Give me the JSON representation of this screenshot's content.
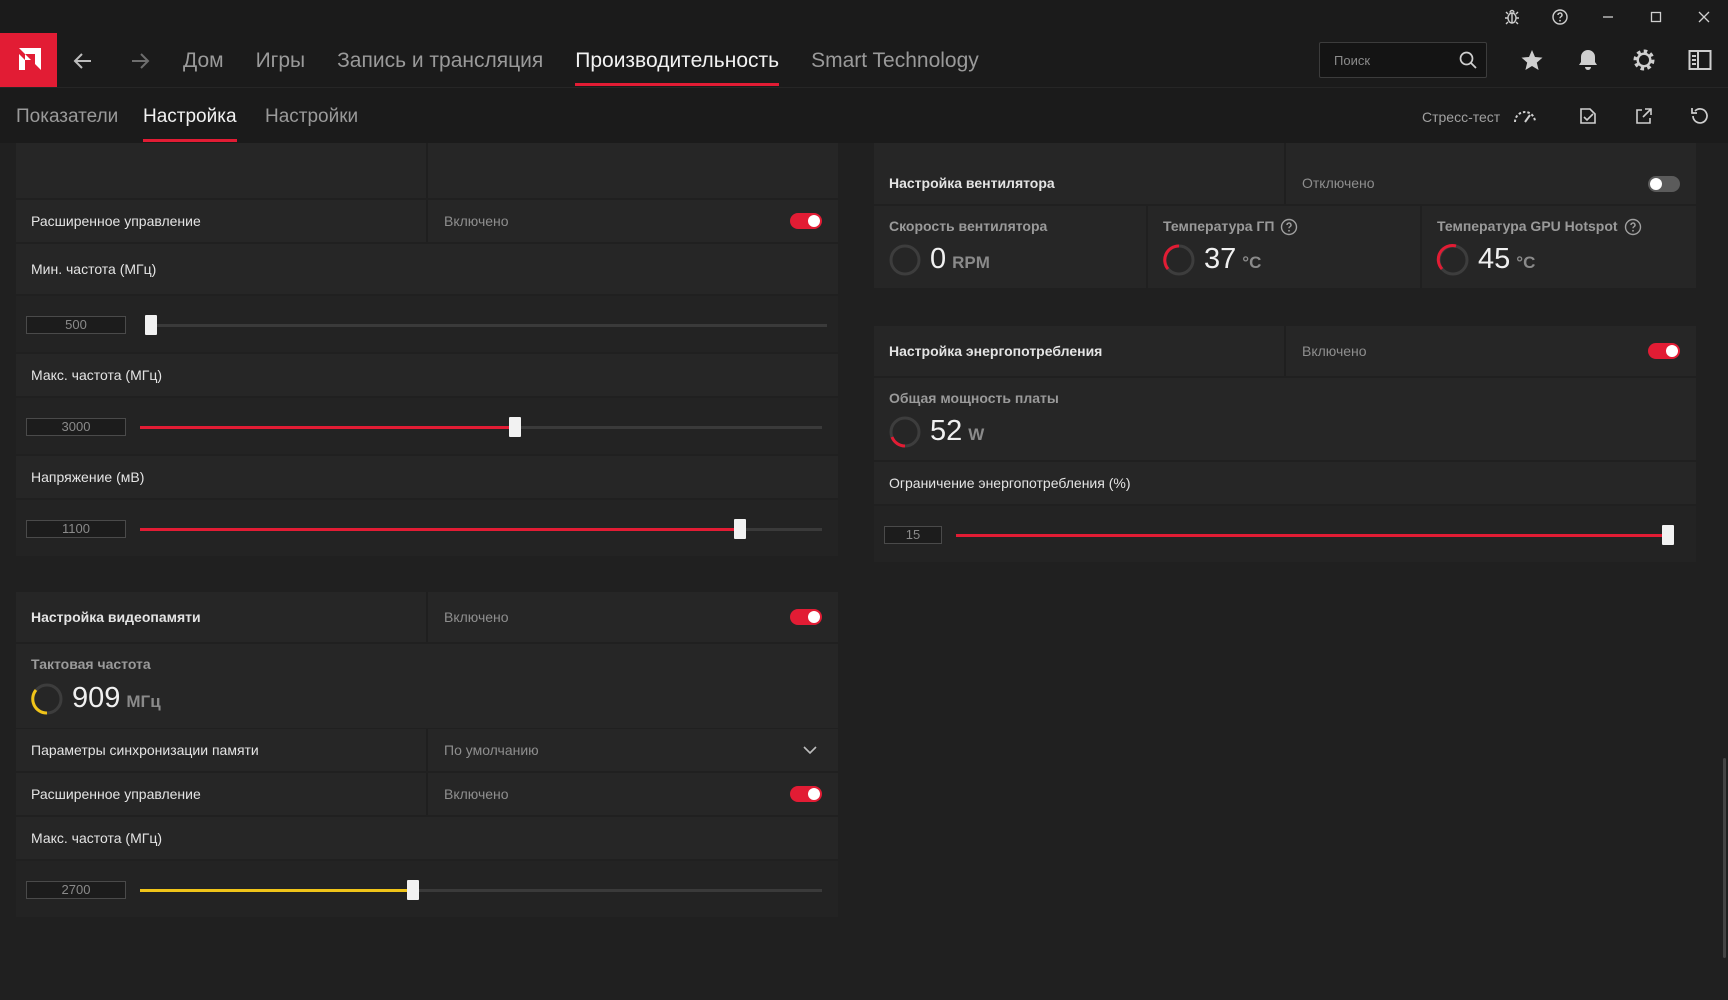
{
  "nav": {
    "tabs": [
      {
        "label": "Дом"
      },
      {
        "label": "Игры"
      },
      {
        "label": "Запись и трансляция"
      },
      {
        "label": "Производительность"
      },
      {
        "label": "Smart Technology"
      }
    ],
    "search_placeholder": "Поиск"
  },
  "subnav": {
    "tabs": [
      {
        "label": "Показатели"
      },
      {
        "label": "Настройка"
      },
      {
        "label": "Настройки"
      }
    ],
    "stress_test": "Стресс-тест"
  },
  "gpu": {
    "advanced_label": "Расширенное управление",
    "advanced_value": "Включено",
    "min_freq_label": "Мин. частота (МГц)",
    "min_freq_value": "500",
    "min_freq_fraction": 0.0,
    "max_freq_label": "Макс. частота (МГц)",
    "max_freq_value": "3000",
    "max_freq_fraction": 0.55,
    "voltage_label": "Напряжение (мВ)",
    "voltage_value": "1100",
    "voltage_fraction": 0.88
  },
  "vram": {
    "header_label": "Настройка видеопамяти",
    "header_value": "Включено",
    "clock_label": "Тактовая частота",
    "clock_value": "909",
    "clock_unit": "МГц",
    "timing_label": "Параметры синхронизации памяти",
    "timing_value": "По умолчанию",
    "advanced_label": "Расширенное управление",
    "advanced_value": "Включено",
    "max_freq_label": "Макс. частота (МГц)",
    "max_freq_value": "2700",
    "max_freq_fraction": 0.4
  },
  "fan": {
    "header_label": "Настройка вентилятора",
    "header_value": "Отключено",
    "speed_label": "Скорость вентилятора",
    "speed_value": "0",
    "speed_unit": "RPM",
    "gpu_temp_label": "Температура ГП",
    "gpu_temp_value": "37",
    "gpu_temp_unit": "°C",
    "hotspot_label": "Температура GPU Hotspot",
    "hotspot_value": "45",
    "hotspot_unit": "°C"
  },
  "power": {
    "header_label": "Настройка энергопотребления",
    "header_value": "Включено",
    "board_power_label": "Общая мощность платы",
    "board_power_value": "52",
    "board_power_unit": "W",
    "limit_label": "Ограничение энергопотребления (%)",
    "limit_value": "15",
    "limit_fraction": 1.0
  },
  "colors": {
    "accent": "#e21c34",
    "memory_accent": "#f0c419"
  }
}
